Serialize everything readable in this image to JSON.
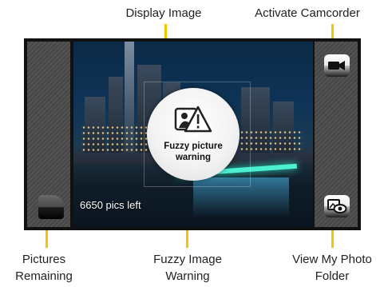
{
  "callouts": {
    "display_image": "Display Image",
    "activate_camcorder": "Activate Camcorder",
    "pictures_remaining_line1": "Pictures",
    "pictures_remaining_line2": "Remaining",
    "fuzzy_image_line1": "Fuzzy Image",
    "fuzzy_image_line2": "Warning",
    "view_photo_line1": "View My Photo",
    "view_photo_line2": "Folder"
  },
  "screen": {
    "pics_left": "6650 pics left",
    "warning_line1": "Fuzzy picture",
    "warning_line2": "warning"
  },
  "icons": {
    "camcorder": "camcorder-icon",
    "photo_folder": "photo-folder-icon",
    "thumbnail": "last-picture-thumbnail",
    "fuzzy_warning": "fuzzy-warning-icon"
  },
  "colors": {
    "leader": "#f5c400",
    "frame": "#111111",
    "side_panel": "#4a4a4a"
  }
}
